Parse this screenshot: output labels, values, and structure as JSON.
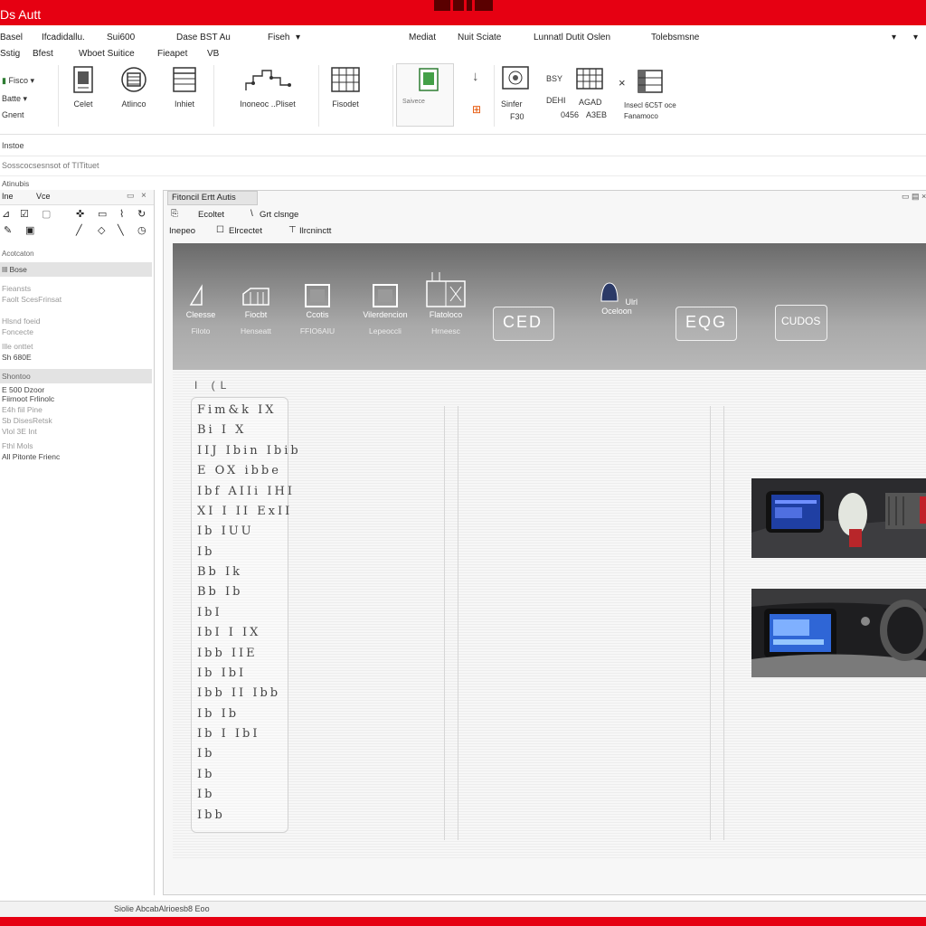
{
  "app": {
    "title": "Ds Autt",
    "accent_color": "#e60012"
  },
  "menu": {
    "items": [
      "Basel",
      "Ifcadidallu.",
      "Sui600",
      "Dase BST Au",
      "Fiseh",
      "Mediat",
      "Nuit Sciate",
      "Lunnatl Dutit Oslen",
      "Tolebsmsne"
    ]
  },
  "subbar": {
    "items": [
      "Sstig",
      "Bfest",
      "Wboet Suitice",
      "Fieapet",
      "VB"
    ]
  },
  "ribbon": {
    "small_left": [
      "Fisco",
      "Batte",
      "Gnent"
    ],
    "buttons": [
      {
        "label": "Celet",
        "icon": "document-icon"
      },
      {
        "label": "Atlinco",
        "icon": "chip-icon"
      },
      {
        "label": "Inhiet",
        "icon": "list-icon"
      },
      {
        "label": "Inoneoc ..Pliset",
        "icon": "graph-icon"
      },
      {
        "label": "Fisodet",
        "icon": "grid-icon"
      }
    ],
    "right_labels": [
      "Saivece",
      "Sinfer",
      "F30",
      "BSY",
      "DEHI",
      "AGAD",
      "0456",
      "A3EB",
      "Insecl 6C5T oce",
      "Fanamoco"
    ]
  },
  "bar2": {
    "text": "Instoe"
  },
  "bar3": {
    "text": "Sosscocsesnsot of TITituet"
  },
  "bar4": {
    "text": "Atinubis"
  },
  "left_panel": {
    "header": [
      "Ine",
      "Vce"
    ],
    "section1_title": "Acotcaton",
    "section1_selected": "Ill Bose",
    "section1_lines": [
      "Fieansts",
      "Faolt ScesFrinsat",
      "Hlsnd foeid",
      "Foncecte",
      "Ille onttet",
      "Sh 680E"
    ],
    "section2_title": "Shontoo",
    "section2_lines": [
      "E 500 Dzoor",
      "Fiirnoot Frlinolc",
      "E4h fiil Pine",
      "Sb DisesRetsk",
      "Vlol 3E Int",
      "Fthl Mols",
      "All Pitonte Frienc"
    ]
  },
  "main": {
    "tab": "Fitoncil Ertt Autis",
    "toolbar_row1": [
      "Ecoltet",
      "Grt clsnge"
    ],
    "toolbar_row2": [
      "Inepeo",
      "Elrcectet",
      "Ilrcninctt"
    ],
    "band_items": [
      {
        "label": "Cleesse",
        "sub": "Filoto"
      },
      {
        "label": "Fiocbt",
        "sub": "Henseatt"
      },
      {
        "label": "Ccotis",
        "sub": "FFIO6AIU"
      },
      {
        "label": "Vilerdencion",
        "sub": "Lepeoccli"
      },
      {
        "label": "Flatoloco",
        "sub": "Hrneesc"
      },
      {
        "label": "Ulrl Oceloon",
        "sub": ""
      }
    ],
    "band_buttons": [
      "CED",
      "EQG",
      "CUDOS"
    ],
    "canvas_label": "I (L",
    "glyph_rows": [
      "Fim&k  IX",
      "Bi  I X",
      "IIJ   Ibin  Ibib",
      "E   OX   ibbe",
      "Ibf  AIIi   IHI",
      "XI  I  II  ExII",
      "Ib   IUU",
      "Ib",
      "Bb   Ik",
      "Bb   Ib",
      "IbI",
      "IbI   I  IX",
      "Ibb   IIE",
      "Ib   IbI",
      "Ibb   II  Ibb",
      "Ib   Ib",
      "Ib   I   IbI",
      "Ib",
      "Ib",
      "Ib",
      "Ibb"
    ]
  },
  "status": {
    "text": "Siolie AbcabAlrioesb8 Eoo"
  }
}
